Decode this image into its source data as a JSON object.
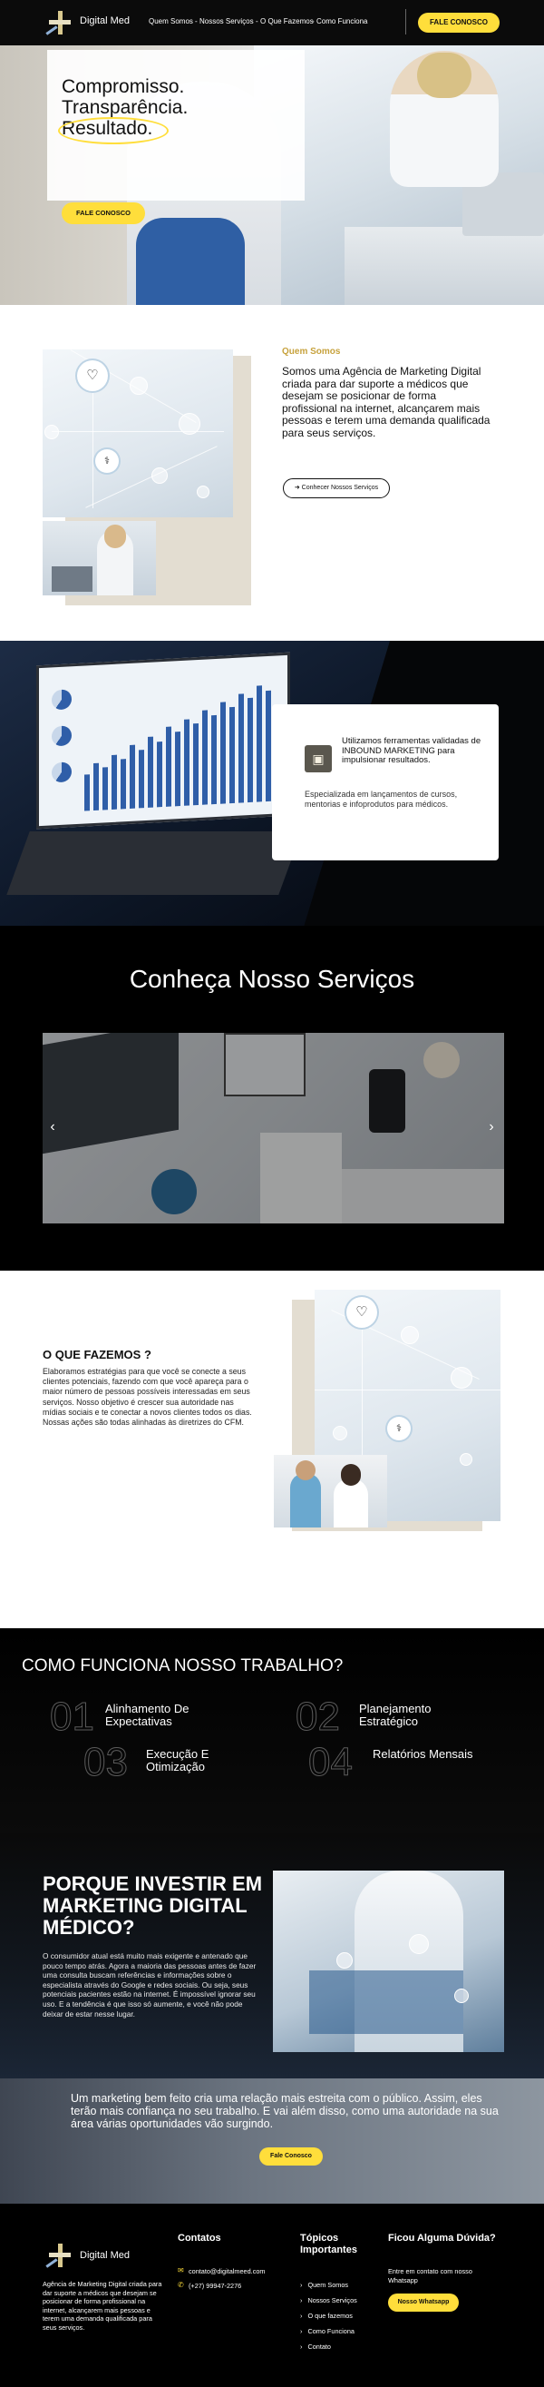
{
  "header": {
    "logo_text": "Digital Med",
    "nav": [
      "Quem Somos",
      "Nossos Serviços",
      "O Que Fazemos",
      "Como Funciona"
    ],
    "nav_separator": "-",
    "cta": "FALE CONOSCO"
  },
  "hero": {
    "title_line1": "Compromisso.",
    "title_line2": "Transparência.",
    "title_line3": "Resultado.",
    "cta": "FALE CONOSCO"
  },
  "about": {
    "label": "Quem Somos",
    "text": "Somos uma Agência de Marketing Digital criada para dar suporte a médicos que desejam se posicionar de forma profissional na internet, alcançarem mais pessoas e terem uma demanda qualificada para seus serviços.",
    "button": "➜ Conhecer Nossos Serviços"
  },
  "inbound": {
    "heading": "Utilizamos ferramentas validadas de INBOUND MARKETING para impulsionar resultados.",
    "text": "Especializada em lançamentos de cursos, mentorias e infoprodutos para médicos."
  },
  "services": {
    "title": "Conheça Nosso Serviços",
    "prev": "‹",
    "next": "›"
  },
  "what": {
    "title": "O QUE FAZEMOS ?",
    "text": "Elaboramos estratégias para que você se conecte a seus clientes potenciais, fazendo com que você apareça para o maior número de pessoas possíveis interessadas em seus serviços. Nosso objetivo é crescer sua autoridade nas mídias sociais e te conectar a novos clientes todos os dias. Nossas ações são todas alinhadas às diretrizes do CFM."
  },
  "how": {
    "title": "COMO FUNCIONA NOSSO TRABALHO?",
    "steps": [
      {
        "num": "01",
        "label": "Alinhamento De Expectativas"
      },
      {
        "num": "02",
        "label": "Planejamento Estratégico"
      },
      {
        "num": "03",
        "label": "Execução E Otimização"
      },
      {
        "num": "04",
        "label": "Relatórios Mensais"
      }
    ]
  },
  "why": {
    "title": "PORQUE INVESTIR EM MARKETING DIGITAL MÉDICO?",
    "text": "O consumidor atual está muito mais exigente e antenado que pouco tempo atrás. Agora a maioria das pessoas antes de fazer uma consulta buscam referências e informações sobre o especialista através do Google e redes sociais. Ou seja, seus potenciais pacientes estão na internet. É impossível ignorar seu uso. E a tendência é que isso só aumente, e você não pode deixar de estar nesse lugar."
  },
  "banner": {
    "text": "Um marketing bem feito cria uma relação mais estreita com o público. Assim, eles terão mais confiança no seu trabalho. E vai além disso, como uma autoridade na sua área várias oportunidades vão surgindo.",
    "cta": "Fale Conosco"
  },
  "footer": {
    "logo_text": "Digital Med",
    "about": "Agência de Marketing Digital criada para dar suporte a médicos que desejam se posicionar de forma profissional na internet, alcançarem mais pessoas e terem uma demanda qualificada para seus serviços.",
    "contacts_title": "Contatos",
    "email": "contato@digitalmeed.com",
    "phone": "(+27) 99947-2276",
    "topics_title": "Tópicos Importantes",
    "topics": [
      "Quem Somos",
      "Nossos Serviços",
      "O que fazemos",
      "Como Funciona",
      "Contato"
    ],
    "doubt_title": "Ficou Alguma Dúvida?",
    "doubt_text": "Entre em contato com nosso Whatsapp",
    "whatsapp": "Nosso Whatsapp"
  },
  "colors": {
    "accent_yellow": "#ffde3b",
    "gold_label": "#c7a23d",
    "dark": "#000000"
  },
  "icons": [
    "heart-icon",
    "email-icon",
    "phone-icon",
    "presentation-icon",
    "arrow-right-icon"
  ]
}
